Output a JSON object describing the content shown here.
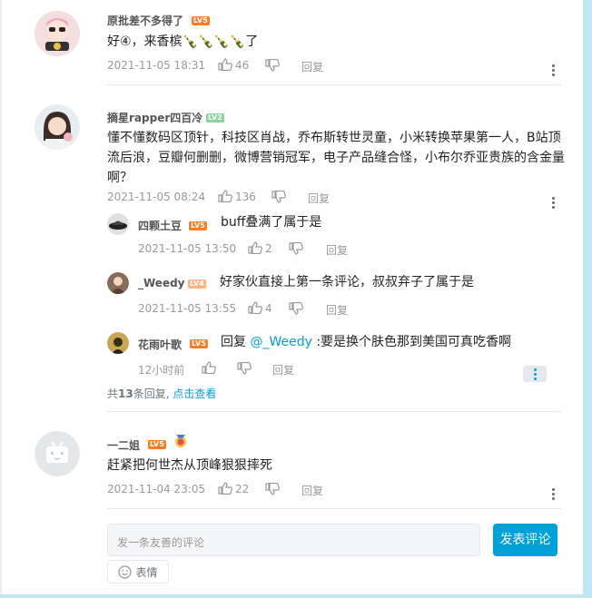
{
  "comments": [
    {
      "user": "原批差不多得了",
      "level": "LV5",
      "text": "好④，来香槟🍾🍾🍾🍾了",
      "time": "2021-11-05 18:31",
      "likes": "46",
      "reply_label": "回复"
    },
    {
      "user": "摘星rapper四百冷",
      "level": "LV2",
      "text": "懂不懂数码区顶针，科技区肖战，乔布斯转世灵童，小米转换苹果第一人，B站顶流后浪，豆瓣何删删，微博营销冠军，电子产品缝合怪，小布尔乔亚贵族的含金量啊？",
      "time": "2021-11-05 08:24",
      "likes": "136",
      "reply_label": "回复",
      "replies": [
        {
          "user": "四颗土豆",
          "level": "LV5",
          "text": "buff叠满了属于是",
          "time": "2021-11-05 13:50",
          "likes": "2",
          "reply_label": "回复"
        },
        {
          "user": "_Weedy",
          "level": "LV4",
          "text": "好家伙直接上第一条评论，叔叔弃子了属于是",
          "time": "2021-11-05 13:55",
          "likes": "4",
          "reply_label": "回复"
        },
        {
          "user": "花雨叶歌",
          "level": "LV5",
          "text_prefix": "回复",
          "mention": "@_Weedy",
          "text_suffix": ":要是换个肤色那到美国可真吃香啊",
          "time": "12小时前",
          "likes": "",
          "reply_label": "回复"
        }
      ],
      "more_prefix": "共",
      "more_count": "13",
      "more_suffix": "条回复,",
      "more_link": "点击查看"
    },
    {
      "user": "一二姐",
      "level": "LV5",
      "text": "赶紧把何世杰从顶峰狠狠摔死",
      "time": "2021-11-04 23:05",
      "likes": "22",
      "reply_label": "回复"
    }
  ],
  "editor": {
    "placeholder": "发一条友善的评论",
    "submit_label": "发表评论",
    "emoji_label": "表情"
  },
  "colors": {
    "accent": "#00a1d6",
    "lv5": "#fe7c22",
    "lv2": "#8bd29b",
    "lv4": "#ffb37c"
  }
}
